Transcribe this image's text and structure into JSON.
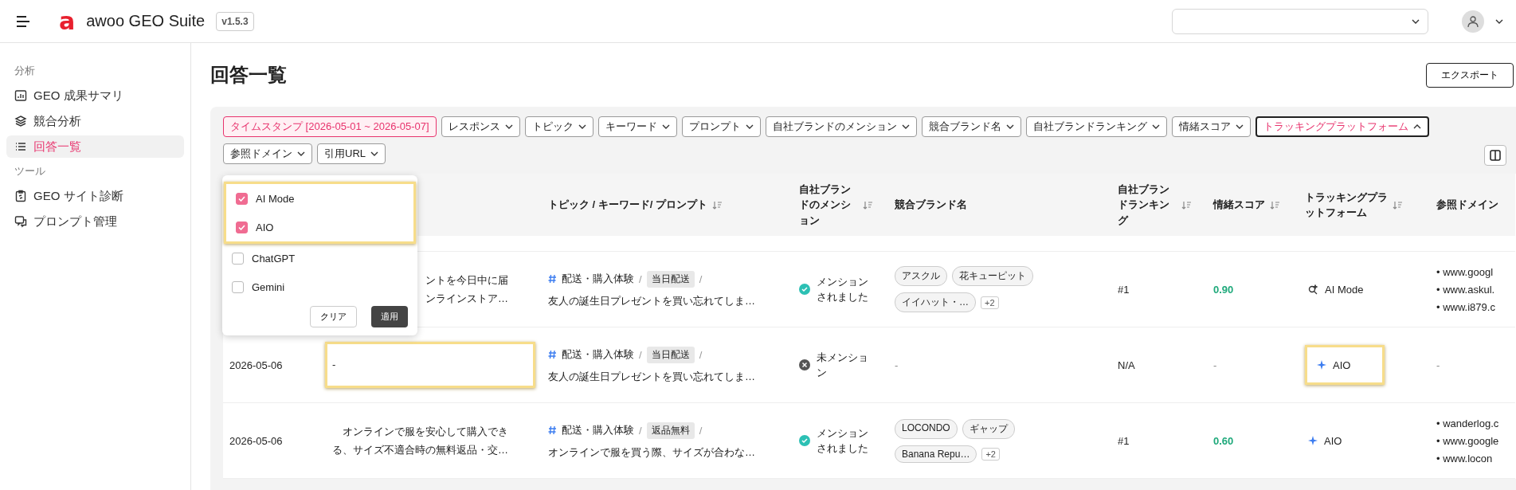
{
  "header": {
    "logo_mark": "a",
    "app_name": "awoo GEO Suite",
    "version": "v1.5.3"
  },
  "sidebar": [
    {
      "title": "分析",
      "items": [
        {
          "label": "GEO 成果サマリ",
          "selected": false
        },
        {
          "label": "競合分析",
          "selected": false
        },
        {
          "label": "回答一覧",
          "selected": true
        }
      ]
    },
    {
      "title": "ツール",
      "items": [
        {
          "label": "GEO サイト診断",
          "selected": false
        },
        {
          "label": "プロンプト管理",
          "selected": false
        }
      ]
    }
  ],
  "page": {
    "title": "回答一覧",
    "export_button": "エクスポート"
  },
  "filters": [
    {
      "label": "タイムスタンプ [2026-05-01 ~ 2026-05-07]",
      "kind": "date",
      "applied": true,
      "open": false
    },
    {
      "label": "レスポンス",
      "kind": "select",
      "applied": false,
      "open": false
    },
    {
      "label": "トピック",
      "kind": "select",
      "applied": false,
      "open": false
    },
    {
      "label": "キーワード",
      "kind": "select",
      "applied": false,
      "open": false
    },
    {
      "label": "プロンプト",
      "kind": "select",
      "applied": false,
      "open": false
    },
    {
      "label": "自社ブランドのメンション",
      "kind": "select",
      "applied": false,
      "open": false
    },
    {
      "label": "競合ブランド名",
      "kind": "select",
      "applied": false,
      "open": false
    },
    {
      "label": "自社ブランドランキング",
      "kind": "select",
      "applied": false,
      "open": false
    },
    {
      "label": "情緒スコア",
      "kind": "select",
      "applied": false,
      "open": false
    },
    {
      "label": "トラッキングプラットフォーム",
      "kind": "select",
      "applied": true,
      "open": true
    },
    {
      "label": "参照ドメイン",
      "kind": "select",
      "applied": false,
      "open": false
    },
    {
      "label": "引用URL",
      "kind": "select",
      "applied": false,
      "open": false
    }
  ],
  "dropdown": {
    "options": [
      {
        "label": "AI Mode",
        "checked": true,
        "highlighted": true
      },
      {
        "label": "AIO",
        "checked": true,
        "highlighted": true
      },
      {
        "label": "ChatGPT",
        "checked": false,
        "highlighted": false
      },
      {
        "label": "Gemini",
        "checked": false,
        "highlighted": false
      }
    ],
    "clear_button": "クリア",
    "apply_button": "適用"
  },
  "table": {
    "columns": [
      {
        "label": "トピック / キーワード/ プロンプト",
        "sortable": true
      },
      {
        "label": "自社ブランドのメンション",
        "sortable": true
      },
      {
        "label": "競合ブランド名",
        "sortable": false
      },
      {
        "label": "自社ブランドランキング",
        "sortable": true
      },
      {
        "label": "情緒スコア",
        "sortable": true
      },
      {
        "label": "トラッキングプラットフォーム",
        "sortable": true
      },
      {
        "label": "参照ドメイン",
        "sortable": false
      }
    ],
    "rows": [
      {
        "response_lines": [
          "ントを今日中に届",
          "ンラインストア…"
        ],
        "response_highlighted": false,
        "topic": "配送・購入体験",
        "tag": "当日配送",
        "separator": "/",
        "prompt": "友人の誕生日プレゼントを買い忘れてしま…",
        "mention": {
          "kind": "mentioned",
          "label": "メンションされました"
        },
        "competitors": [
          "アスクル",
          "花キューピット",
          "イイハット・…"
        ],
        "more": "+2",
        "ranking": "#1",
        "score": "0.90",
        "score_good": true,
        "platform": {
          "kind": "ai_mode",
          "label": "AI Mode"
        },
        "platform_highlighted": false,
        "domains": [
          "• www.googl",
          "• www.askul.",
          "• www.i879.c"
        ]
      },
      {
        "date": "2026-05-06",
        "response_lines": [
          "-"
        ],
        "response_highlighted": true,
        "topic": "配送・購入体験",
        "tag": "当日配送",
        "separator": "/",
        "prompt": "友人の誕生日プレゼントを買い忘れてしま…",
        "mention": {
          "kind": "not_mentioned",
          "label": "未メンション"
        },
        "competitors_empty": "-",
        "ranking": "N/A",
        "score": "-",
        "score_good": false,
        "platform": {
          "kind": "aio",
          "label": "AIO"
        },
        "platform_highlighted": true,
        "domains_empty": "-"
      },
      {
        "date": "2026-05-06",
        "response_lines": [
          "オンラインで服を安心して購入でき",
          "る、サイズ不適合時の無料返品・交…"
        ],
        "response_highlighted": false,
        "topic": "配送・購入体験",
        "tag": "返品無料",
        "separator": "/",
        "prompt": "オンラインで服を買う際、サイズが合わな…",
        "mention": {
          "kind": "mentioned",
          "label": "メンションされました"
        },
        "competitors": [
          "LOCONDO",
          "ギャップ",
          "Banana Repu…"
        ],
        "more": "+2",
        "ranking": "#1",
        "score": "0.60",
        "score_good": true,
        "platform": {
          "kind": "aio",
          "label": "AIO"
        },
        "platform_highlighted": false,
        "domains": [
          "• wanderlog.c",
          "• www.google",
          "• www.locon"
        ]
      }
    ]
  }
}
